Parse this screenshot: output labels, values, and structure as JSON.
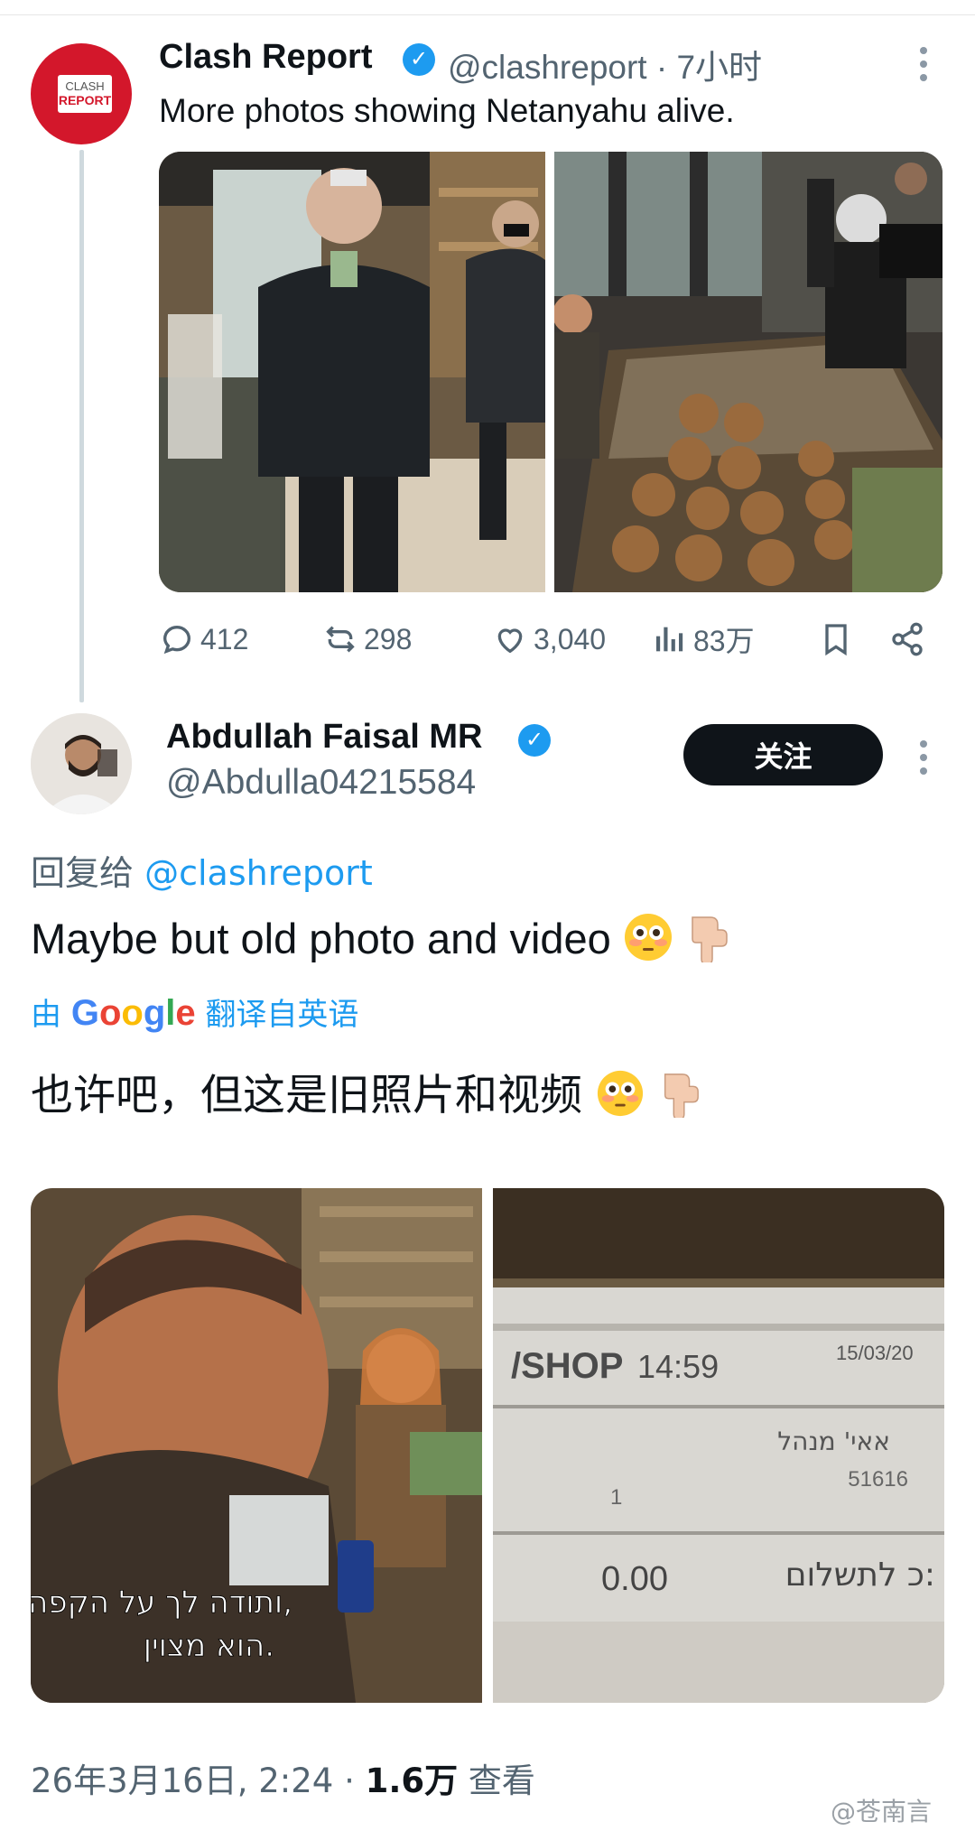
{
  "parent": {
    "name": "Clash Report",
    "handle_time": "@clashreport · 7小时",
    "text": "More photos showing Netanyahu alive.",
    "avatar_logo": [
      "CLASH",
      "REPORT"
    ],
    "actions": {
      "replies": "412",
      "reposts": "298",
      "likes": "3,040",
      "views": "83万"
    }
  },
  "reply": {
    "name": "Abdullah Faisal MR",
    "handle": "@Abdulla04215584",
    "follow_label": "关注",
    "reply_prefix": "回复给",
    "reply_mention": "@clashreport",
    "text": "Maybe but old photo and video",
    "translate_by": "由",
    "translate_brand": "Google",
    "translate_suffix": "翻译自英语",
    "translated_text": "也许吧，但这是旧照片和视频",
    "video_caption_line1": "ותודה לך על הקפה,",
    "video_caption_line2": "הוא מצוין.",
    "receipt": {
      "shop": "/SHOP",
      "time": "14:59",
      "date": "15/03/20",
      "line_name": "אאי' מנהל",
      "line_code": "51616",
      "qty": "1",
      "total_label": "כ לתשלום:",
      "total_value": "0.00"
    }
  },
  "footer": {
    "date_time": "26年3月16日, 2:24 · ",
    "views_count": "1.6万",
    "views_label": " 查看",
    "watermark": "@苍南言"
  },
  "colors": {
    "accent": "#1d9bf0",
    "text": "#0f1419",
    "secondary": "#536471",
    "brand_red": "#d3172b"
  },
  "icons": [
    "verified-icon",
    "more-icon",
    "reply-icon",
    "repost-icon",
    "like-icon",
    "views-icon",
    "bookmark-icon",
    "share-icon",
    "flushed-face-emoji",
    "pointing-down-emoji"
  ]
}
